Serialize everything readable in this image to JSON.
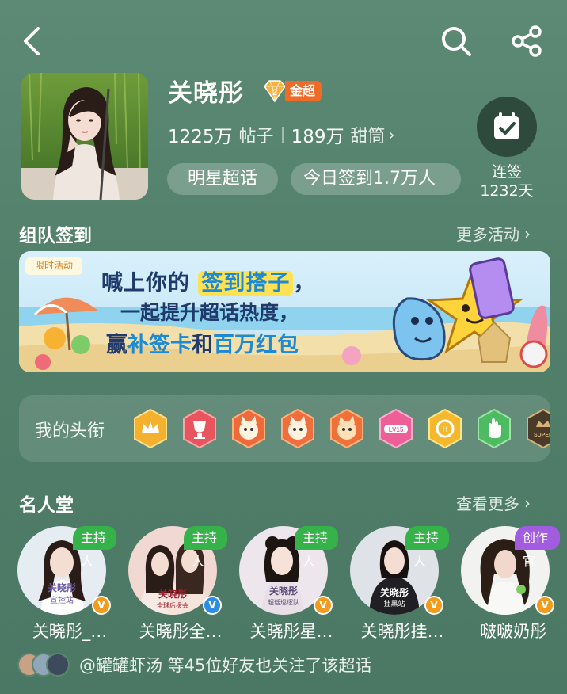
{
  "header": {
    "back_icon": "chevron-left-icon",
    "search_icon": "search-icon",
    "share_icon": "share-icon"
  },
  "topic": {
    "title": "关晓彤",
    "level_badge": "金超",
    "level_badge_color": "#f06a28",
    "posts_count": "1225万",
    "posts_label": "帖子",
    "fans_count": "189万",
    "fans_label": "甜筒",
    "tag_category": "明星超话",
    "tag_checkin_today": "今日签到1.7万人"
  },
  "checkin": {
    "icon": "calendar-check-icon",
    "label_line1": "连签",
    "label_line2": "1232天"
  },
  "team_checkin": {
    "title": "组队签到",
    "more_label": "更多活动",
    "banner": {
      "tag": "限时活动",
      "line1_a": "喊上你的",
      "line1_b": "签到搭子",
      "line1_c": "，",
      "line2": "一起提升超话热度，",
      "line3_a": "赢",
      "line3_b": "补签卡",
      "line3_c": "和",
      "line3_d": "百万红包"
    }
  },
  "titles": {
    "label": "我的头衔",
    "badges": [
      "crown-badge",
      "trophy-badge",
      "cat-badge",
      "cat-badge",
      "cat-badge",
      "lv15-badge",
      "medal-badge",
      "hand-badge",
      "super-badge"
    ]
  },
  "hall_of_fame": {
    "title": "名人堂",
    "more_label": "查看更多",
    "members": [
      {
        "name": "关晓彤_…",
        "role": "主持人",
        "avatar_caption": "关晓彤宣控站",
        "verify": "orange"
      },
      {
        "name": "关晓彤全…",
        "role": "主持人",
        "avatar_caption": "关晓彤全球后援会",
        "verify": "blue"
      },
      {
        "name": "关晓彤星…",
        "role": "主持人",
        "avatar_caption": "关晓彤超话巡逻队",
        "verify": "orange"
      },
      {
        "name": "关晓彤挂…",
        "role": "主持人",
        "avatar_caption": "关晓彤挂黑站",
        "verify": "orange"
      },
      {
        "name": "啵啵奶彤",
        "role": "创作官",
        "avatar_caption": "",
        "verify": "orange"
      }
    ]
  },
  "friends": {
    "text": "@罐罐虾汤 等45位好友也关注了该超话"
  }
}
